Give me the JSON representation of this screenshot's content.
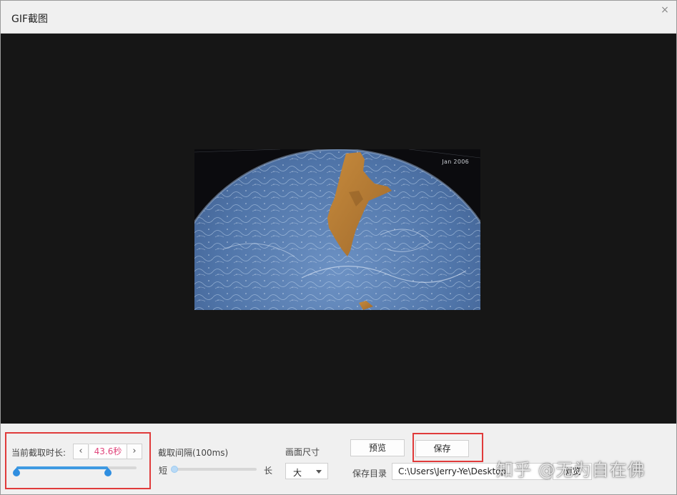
{
  "window": {
    "title": "GIF截图",
    "close_glyph": "×"
  },
  "preview": {
    "date_label": "Jan 2006"
  },
  "duration": {
    "label": "当前截取时长:",
    "prev_glyph": "‹",
    "next_glyph": "›",
    "value": "43.6秒",
    "range_start": 0.0,
    "range_end": 0.76
  },
  "interval": {
    "label": "截取间隔(100ms)",
    "min_label": "短",
    "max_label": "长",
    "level": 0.0
  },
  "size": {
    "label": "画面尺寸",
    "selected": "大"
  },
  "actions": {
    "preview_label": "预览",
    "save_label": "保存"
  },
  "save_dir": {
    "label": "保存目录",
    "path": "C:\\Users\\Jerry-Ye\\Desktop",
    "browse_label": "浏览"
  },
  "watermark": {
    "text": "知乎 @无为自在佛"
  },
  "colors": {
    "accent": "#3f9ae2",
    "duration_value": "#e0457b",
    "highlight": "#e03b3b",
    "stage": "#161616"
  }
}
